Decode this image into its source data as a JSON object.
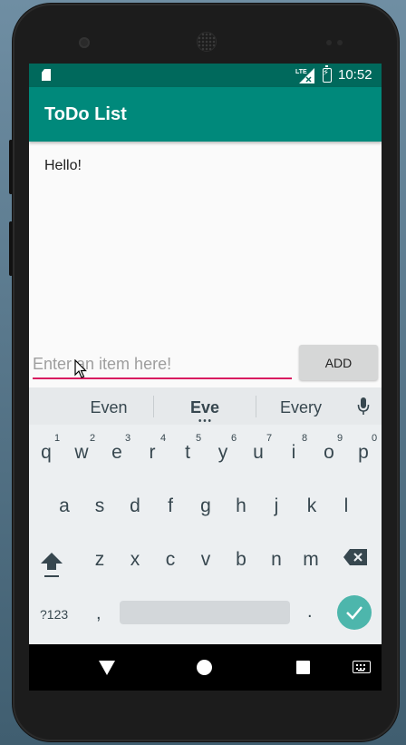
{
  "status_bar": {
    "time": "10:52",
    "network": "LTE",
    "icons": [
      "sd-card-icon",
      "signal-icon",
      "battery-charging-icon"
    ]
  },
  "app_bar": {
    "title": "ToDo List"
  },
  "todo_list": {
    "items": [
      "Hello!"
    ]
  },
  "entry": {
    "placeholder": "Enter an item here!",
    "value": "",
    "add_label": "ADD"
  },
  "colors": {
    "status_bar": "#00695c",
    "app_bar": "#00897b",
    "input_underline": "#d81b60",
    "enter_key": "#4db6ac"
  },
  "keyboard": {
    "suggestions": [
      "Even",
      "Eve",
      "Every"
    ],
    "row1": [
      {
        "key": "q",
        "hint": "1"
      },
      {
        "key": "w",
        "hint": "2"
      },
      {
        "key": "e",
        "hint": "3"
      },
      {
        "key": "r",
        "hint": "4"
      },
      {
        "key": "t",
        "hint": "5"
      },
      {
        "key": "y",
        "hint": "6"
      },
      {
        "key": "u",
        "hint": "7"
      },
      {
        "key": "i",
        "hint": "8"
      },
      {
        "key": "o",
        "hint": "9"
      },
      {
        "key": "p",
        "hint": "0"
      }
    ],
    "row2": [
      "a",
      "s",
      "d",
      "f",
      "g",
      "h",
      "j",
      "k",
      "l"
    ],
    "row3": [
      "z",
      "x",
      "c",
      "v",
      "b",
      "n",
      "m"
    ],
    "symbols_label": "?123",
    "comma": ",",
    "period": "."
  },
  "nav_bar": {
    "icons": [
      "back-icon",
      "home-icon",
      "recents-icon",
      "keyboard-switch-icon"
    ]
  }
}
